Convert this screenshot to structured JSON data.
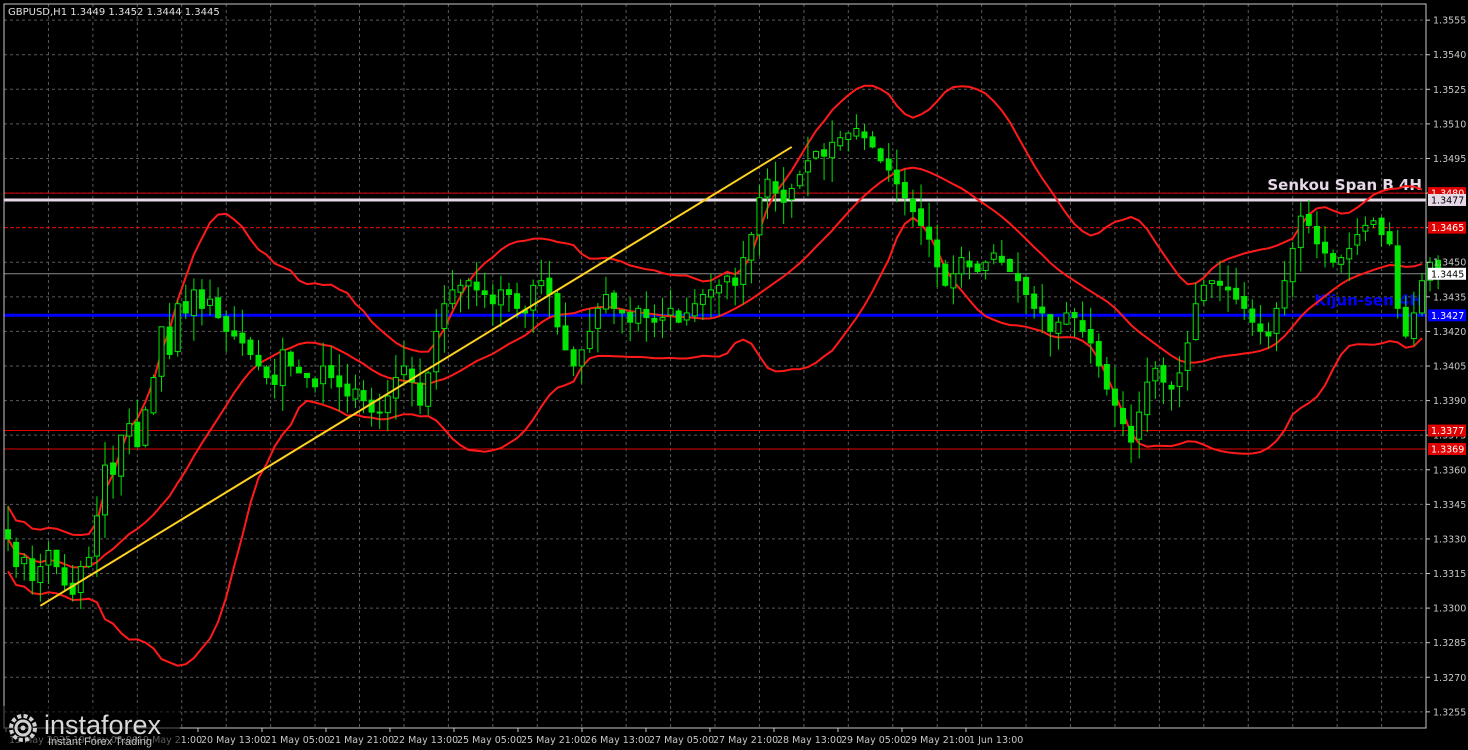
{
  "header": {
    "symbol_info": "GBPUSD,H1  1.3449 1.3452 1.3444 1.3445"
  },
  "logo": {
    "brand": "instaforex",
    "tagline": "Instant Forex Trading"
  },
  "colors": {
    "background": "#000000",
    "grid": "#5a5a5a",
    "axis": "#c8c8c8",
    "bull": "#00e600",
    "bear": "#00e600",
    "bollinger": "#ff1a1a",
    "trendline": "#ffd21f",
    "kijun": "#0000ff",
    "senkou": "#e6d8e6",
    "level": "#e00000",
    "price": "#ffffff"
  },
  "chart_data": {
    "type": "line",
    "ylim": [
      1.3248,
      1.3562
    ],
    "y_ticks": [
      1.3555,
      1.354,
      1.3525,
      1.351,
      1.3495,
      1.348,
      1.3465,
      1.345,
      1.3435,
      1.342,
      1.3405,
      1.339,
      1.3375,
      1.336,
      1.3345,
      1.333,
      1.3315,
      1.33,
      1.3285,
      1.327,
      1.3255
    ],
    "x_labels": [
      "15 May 2025",
      "19 May 05:00",
      "19 May 21:00",
      "20 May 13:00",
      "21 May 05:00",
      "21 May 21:00",
      "22 May 13:00",
      "25 May 05:00",
      "25 May 21:00",
      "26 May 13:00",
      "27 May 05:00",
      "27 May 21:00",
      "28 May 13:00",
      "29 May 05:00",
      "29 May 21:00",
      "1 Jun 13:00"
    ],
    "bars_count": 176,
    "close": [
      1.333,
      1.3318,
      1.3322,
      1.3312,
      1.3318,
      1.3325,
      1.3318,
      1.331,
      1.3306,
      1.3318,
      1.3322,
      1.334,
      1.3362,
      1.3358,
      1.3375,
      1.338,
      1.337,
      1.3386,
      1.34,
      1.3422,
      1.341,
      1.3432,
      1.3428,
      1.3438,
      1.343,
      1.3434,
      1.3426,
      1.342,
      1.3418,
      1.3415,
      1.341,
      1.3405,
      1.34,
      1.3397,
      1.3412,
      1.3405,
      1.3402,
      1.34,
      1.3396,
      1.3405,
      1.34,
      1.3396,
      1.3392,
      1.3395,
      1.339,
      1.3385,
      1.3385,
      1.3392,
      1.34,
      1.3405,
      1.3398,
      1.3388,
      1.3402,
      1.342,
      1.3432,
      1.3438,
      1.344,
      1.3442,
      1.3438,
      1.3436,
      1.3432,
      1.3438,
      1.3436,
      1.343,
      1.3428,
      1.344,
      1.3442,
      1.3436,
      1.3422,
      1.3412,
      1.3405,
      1.3412,
      1.342,
      1.343,
      1.3436,
      1.343,
      1.3428,
      1.3424,
      1.343,
      1.3426,
      1.3424,
      1.3426,
      1.343,
      1.3424,
      1.3428,
      1.3432,
      1.3436,
      1.3438,
      1.344,
      1.3444,
      1.344,
      1.3452,
      1.3462,
      1.3478,
      1.3486,
      1.348,
      1.3476,
      1.3482,
      1.3488,
      1.3494,
      1.3498,
      1.3496,
      1.3502,
      1.3504,
      1.3506,
      1.3508,
      1.3504,
      1.35,
      1.3494,
      1.349,
      1.3484,
      1.3478,
      1.3472,
      1.3466,
      1.346,
      1.3448,
      1.344,
      1.3445,
      1.3452,
      1.3448,
      1.3446,
      1.345,
      1.3454,
      1.345,
      1.3446,
      1.3442,
      1.3436,
      1.343,
      1.3428,
      1.342,
      1.3424,
      1.3428,
      1.3426,
      1.342,
      1.3415,
      1.3405,
      1.3395,
      1.3388,
      1.338,
      1.3372,
      1.3385,
      1.3398,
      1.3404,
      1.3398,
      1.3395,
      1.3402,
      1.3415,
      1.3432,
      1.344,
      1.3442,
      1.344,
      1.3438,
      1.3434,
      1.343,
      1.3424,
      1.342,
      1.3418,
      1.343,
      1.3442,
      1.3456,
      1.347,
      1.3466,
      1.3458,
      1.3454,
      1.345,
      1.3452,
      1.3456,
      1.3462,
      1.3466,
      1.3468,
      1.3462,
      1.3458,
      1.343,
      1.3418,
      1.3428,
      1.3442,
      1.345,
      1.3445
    ],
    "volatility": 0.0011,
    "levels": [
      {
        "value": 1.348,
        "label": "1.3480",
        "style": "solid"
      },
      {
        "value": 1.3465,
        "label": "1.3465",
        "style": "dashed"
      },
      {
        "value": 1.3377,
        "label": "1.3377",
        "style": "solid"
      },
      {
        "value": 1.3369,
        "label": "1.3369",
        "style": "solid"
      }
    ],
    "senkou_span_b": {
      "value": 1.3477,
      "label": "1.3477",
      "name": "Senkou Span B 4H"
    },
    "kijun_sen": {
      "value": 1.3427,
      "label": "1.3427",
      "name": "Kijun-sen 4H"
    },
    "current_price": {
      "value": 1.3445,
      "label": "1.3445"
    },
    "trendline": {
      "from": {
        "bar": 4,
        "price": 1.3301
      },
      "to": {
        "bar": 97,
        "price": 1.35
      }
    },
    "bollinger_period": 20,
    "bollinger_dev": 2
  }
}
